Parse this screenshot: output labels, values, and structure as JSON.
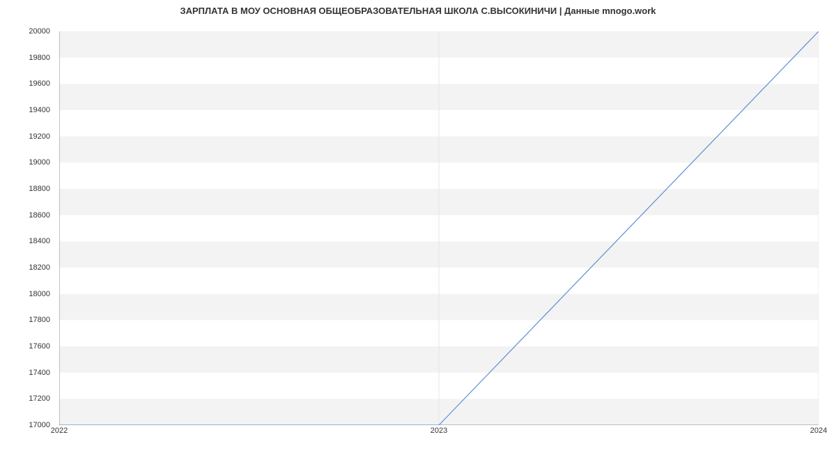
{
  "chart_data": {
    "type": "line",
    "title": "ЗАРПЛАТА В МОУ ОСНОВНАЯ ОБЩЕОБРАЗОВАТЕЛЬНАЯ ШКОЛА С.ВЫСОКИНИЧИ | Данные mnogo.work",
    "x": [
      2022,
      2023,
      2024
    ],
    "y": [
      17000,
      17000,
      20000
    ],
    "xlabel": "",
    "ylabel": "",
    "xlim": [
      2022,
      2024
    ],
    "ylim": [
      17000,
      20000
    ],
    "x_ticks": [
      2022,
      2023,
      2024
    ],
    "y_ticks": [
      17000,
      17200,
      17400,
      17600,
      17800,
      18000,
      18200,
      18400,
      18600,
      18800,
      19000,
      19200,
      19400,
      19600,
      19800,
      20000
    ],
    "line_color": "#5b8fd6",
    "grid": true
  }
}
